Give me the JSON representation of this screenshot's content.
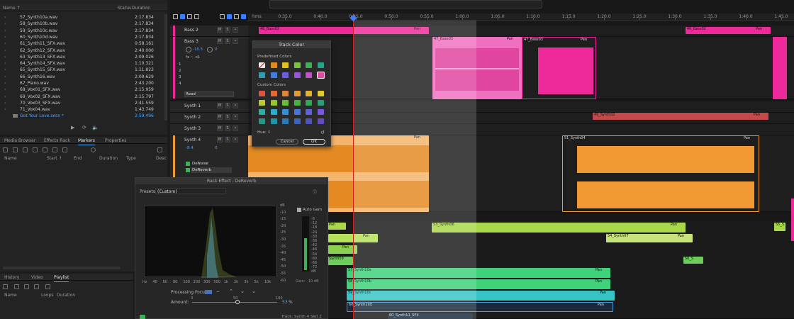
{
  "files_panel": {
    "columns": {
      "name": "Name ↑",
      "status": "Status",
      "duration": "Duration"
    },
    "files": [
      {
        "name": "57_Synth10a.wav",
        "duration": "2:17.834"
      },
      {
        "name": "58_Synth10b.wav",
        "duration": "2:17.834"
      },
      {
        "name": "59_Synth10c.wav",
        "duration": "2:17.834"
      },
      {
        "name": "60_Synth10d.wav",
        "duration": "2:17.834"
      },
      {
        "name": "61_Synth11_SFX.wav",
        "duration": "0:58.161"
      },
      {
        "name": "62_Synth12_SFX.wav",
        "duration": "2:40.000"
      },
      {
        "name": "63_Synth13_SFX.wav",
        "duration": "2:09.026"
      },
      {
        "name": "64_Synth14_SFX.wav",
        "duration": "1:10.321"
      },
      {
        "name": "65_Synth15_SFX.wav",
        "duration": "1:11.823"
      },
      {
        "name": "66_Synth16.wav",
        "duration": "2:09.629"
      },
      {
        "name": "67_Piano.wav",
        "duration": "2:43.200"
      },
      {
        "name": "68_Vox01_SFX.wav",
        "duration": "2:15.959"
      },
      {
        "name": "69_Vox02_SFX.wav",
        "duration": "2:15.797"
      },
      {
        "name": "70_Vox03_SFX.wav",
        "duration": "2:41.559"
      },
      {
        "name": "71_Vox04.wav",
        "duration": "1:43.749"
      }
    ],
    "session_file": {
      "name": "Got Your Love.sesx *",
      "duration": "2:59.496"
    }
  },
  "markers_panel": {
    "tabs": [
      "Media Browser",
      "Effects Rack",
      "Markers",
      "Properties"
    ],
    "active_tab": "Markers",
    "columns": [
      "Name",
      "Start ↑",
      "End",
      "Duration",
      "Type",
      "Desc"
    ]
  },
  "history_panel": {
    "tabs": [
      "History",
      "Video",
      "Playlist"
    ],
    "active_tab": "Playlist",
    "columns": [
      "Name",
      "Loops",
      "Duration"
    ]
  },
  "timeline": {
    "time_format": "hms",
    "ruler": [
      "0:35.0",
      "0:40.0",
      "0:45.0",
      "0:50.0",
      "0:55.0",
      "1:00.0",
      "1:05.0",
      "1:10.0",
      "1:15.0",
      "1:20.0",
      "1:25.0",
      "1:30.0",
      "1:35.0",
      "1:40.0",
      "1:45.0"
    ],
    "playhead_time": "0:45.0",
    "tracks": {
      "bass2": {
        "name": "Bass 2"
      },
      "bass3": {
        "name": "Bass 3",
        "volume": "-10.5",
        "pan": "0",
        "fx_slots": [
          "1",
          "2",
          "3",
          "4"
        ],
        "automation_mode": "Read"
      },
      "synth1": {
        "name": "Synth 1"
      },
      "synth2": {
        "name": "Synth 2"
      },
      "synth3": {
        "name": "Synth 3"
      },
      "synth4": {
        "name": "Synth 4",
        "volume": "-8.4",
        "pan": "0",
        "fx": [
          "DeNoise",
          "DeReverb"
        ]
      }
    },
    "clips": {
      "bass02_a": "46_Bass02",
      "bass02_b": "46_Bass02",
      "bass03_a": "47_Bass03",
      "bass03_b": "47_Bass03",
      "synth02": "49_Synth02",
      "synth04": "51_Synth04",
      "synth06": "53_Synth06",
      "synth07": "54_Synth07",
      "synth08": "55_S",
      "synth09": "Synth09",
      "synth10a": "57_Synth10a",
      "synth10b": "58_Synth10b",
      "synth10c": "59_Synth10c",
      "synth10d": "60_Synth10d",
      "synth11": "60_Synth11_SFX",
      "synth05_short": "56_S",
      "pan": "Pan"
    }
  },
  "track_color_dialog": {
    "title": "Track Color",
    "predefined_label": "Predefined Colors",
    "custom_label": "Custom Colors",
    "hue_label": "Hue:",
    "hue_value": "0",
    "cancel": "Cancel",
    "ok": "OK",
    "predefined": [
      "none",
      "#e08a1e",
      "#e3c21d",
      "#7bc23f",
      "#3fae57",
      "#28a488",
      "#28a0b8",
      "#3f7fe0",
      "#6b5ee0",
      "#9a52e0",
      "#c54ec9",
      "#e04aa0"
    ],
    "custom_rows": [
      [
        "#e0543e",
        "#e06a3a",
        "#e0843a",
        "#e09a36",
        "#e0b432",
        "#e0cc30"
      ],
      [
        "#b8cc2c",
        "#94c42e",
        "#6ebc34",
        "#48b23c",
        "#32a856",
        "#2ca072"
      ],
      [
        "#28b0a0",
        "#2cacc8",
        "#3690d8",
        "#4676e0",
        "#5c62e0",
        "#7858e0"
      ]
    ]
  },
  "rack_effect": {
    "title": "Rack Effect - DeReverb",
    "presets_label": "Presets:",
    "preset_value": "(Custom)",
    "auto_gain": "Auto Gain",
    "db_scale": [
      "dB",
      "-10",
      "-15",
      "-20",
      "-25",
      "-30",
      "-35",
      "-40",
      "-45",
      "-50",
      "-55",
      "-60"
    ],
    "hz_scale": [
      "Hz",
      "40",
      "60",
      "80",
      "100",
      "200",
      "300",
      "500",
      "1k",
      "2k",
      "3k",
      "5k",
      "10k"
    ],
    "meter_scale": [
      "-6",
      "-12",
      "-18",
      "-24",
      "-30",
      "-36",
      "-42",
      "-48",
      "-54",
      "-60",
      "-66",
      "-72",
      "dB"
    ],
    "gain_label": "Gain:",
    "gain_value": "10 dB",
    "processing_focus": "Processing Focus:",
    "amount_label": "Amount:",
    "amount_scale": [
      "0",
      "50",
      "100"
    ],
    "amount_value": "53",
    "amount_unit": "%",
    "footer": {
      "track": "Track: Synth 4",
      "slot": "Slot 2"
    }
  },
  "colors": {
    "accent": "#4ea3ff",
    "playhead": "#d42020",
    "bass": "#ee2a9a",
    "synth_orange": "#f19a34",
    "synth_green": "#a8d84a",
    "synth_lime": "#3fd27a"
  }
}
